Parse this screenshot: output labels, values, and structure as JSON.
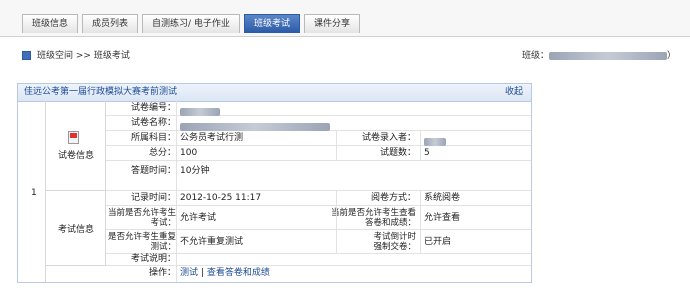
{
  "tabs": [
    {
      "label": "班级信息",
      "active": false
    },
    {
      "label": "成员列表",
      "active": false
    },
    {
      "label": "自测练习/ 电子作业",
      "active": false
    },
    {
      "label": "班级考试",
      "active": true
    },
    {
      "label": "课件分享",
      "active": false
    }
  ],
  "breadcrumb": {
    "home": "班级空间",
    "separator": ">>",
    "current": "班级考试"
  },
  "class_label": "班级：",
  "class_suffix": "）",
  "panel": {
    "title": "佳远公考第一届行政模拟大赛考前测试",
    "collapse": "收起",
    "row_number": "1"
  },
  "paper_info": {
    "group_label": "试卷信息",
    "fields": {
      "paper_no_label": "试卷编号：",
      "paper_name_label": "试卷名称：",
      "subject_label": "所属科目：",
      "subject_value": "公务员考试行测",
      "entry_label": "试卷录入者：",
      "total_label": "总分：",
      "total_value": "100",
      "count_label": "试题数：",
      "count_value": "5",
      "time_label": "答题时间：",
      "time_value": "10分钟"
    }
  },
  "exam_info": {
    "group_label": "考试信息",
    "fields": {
      "record_time_label": "记录时间：",
      "record_time_value": "2012-10-25 11:17",
      "grade_mode_label": "阅卷方式：",
      "grade_mode_value": "系统阅卷",
      "allow_exam_label": "当前是否允许考生考试：",
      "allow_exam_value": "允许考试",
      "allow_view_label": "当前是否允许考生查看答卷和成绩：",
      "allow_view_value": "允许查看",
      "allow_retest_label": "是否允许考生重复测试：",
      "allow_retest_value": "不允许重复测试",
      "countdown_label": "考试倒计时强制交卷：",
      "countdown_value": "已开启",
      "desc_label": "考试说明：",
      "desc_value": ""
    }
  },
  "actions": {
    "label": "操作：",
    "test": "测试",
    "separator": "|",
    "view": "查看答卷和成绩"
  }
}
